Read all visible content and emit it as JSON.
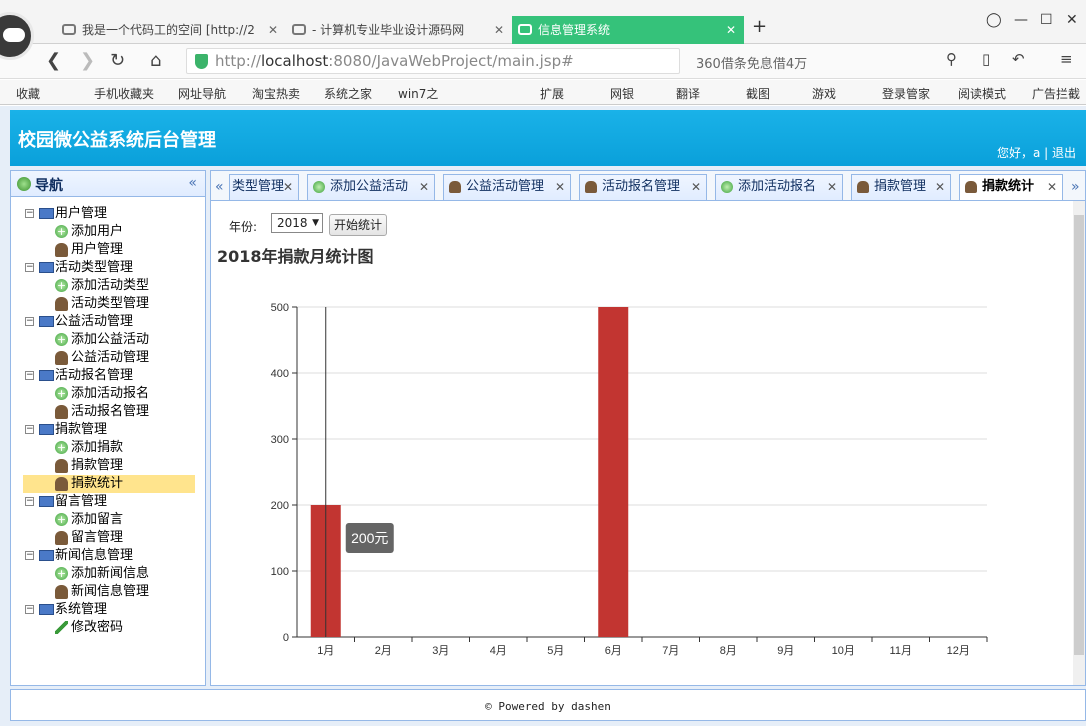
{
  "browser": {
    "tabs": [
      {
        "label": "我是一个代码工的空间 [http://2"
      },
      {
        "label": "- 计算机专业毕业设计源码网"
      },
      {
        "label": "信息管理系统"
      }
    ],
    "new_tab": "+",
    "url_host": "localhost",
    "url_pre": "http://",
    "url_rest": ":8080/JavaWebProject/main.jsp#",
    "news": "360借条免息借4万",
    "bookmarks": [
      "收藏",
      "手机收藏夹",
      "网址导航",
      "淘宝热卖",
      "系统之家",
      "win7之",
      "扩展",
      "网银",
      "翻译",
      "截图",
      "游戏",
      "登录管家",
      "阅读模式",
      "广告拦截"
    ]
  },
  "app": {
    "title": "校园微公益系统后台管理",
    "user_greeting": "您好，a",
    "logout": "退出"
  },
  "nav": {
    "title": "导航",
    "collapse": "«",
    "groups": [
      {
        "label": "用户管理",
        "items": [
          "添加用户",
          "用户管理"
        ]
      },
      {
        "label": "活动类型管理",
        "items": [
          "添加活动类型",
          "活动类型管理"
        ]
      },
      {
        "label": "公益活动管理",
        "items": [
          "添加公益活动",
          "公益活动管理"
        ]
      },
      {
        "label": "活动报名管理",
        "items": [
          "添加活动报名",
          "活动报名管理"
        ]
      },
      {
        "label": "捐款管理",
        "items": [
          "添加捐款",
          "捐款管理",
          "捐款统计"
        ]
      },
      {
        "label": "留言管理",
        "items": [
          "添加留言",
          "留言管理"
        ]
      },
      {
        "label": "新闻信息管理",
        "items": [
          "添加新闻信息",
          "新闻信息管理"
        ]
      },
      {
        "label": "系统管理",
        "items": [
          "修改密码"
        ]
      }
    ]
  },
  "tabs": [
    "类型管理",
    "添加公益活动",
    "公益活动管理",
    "活动报名管理",
    "添加活动报名",
    "捐款管理",
    "捐款统计"
  ],
  "filter": {
    "year_label": "年份:",
    "year_value": "2018",
    "button": "开始统计"
  },
  "chart_title": "2018年捐款月统计图",
  "chart_data": {
    "type": "bar",
    "title": "2018年捐款月统计图",
    "categories": [
      "1月",
      "2月",
      "3月",
      "4月",
      "5月",
      "6月",
      "7月",
      "8月",
      "9月",
      "10月",
      "11月",
      "12月"
    ],
    "values": [
      200,
      0,
      0,
      0,
      0,
      500,
      0,
      0,
      0,
      0,
      0,
      0
    ],
    "ylim": [
      0,
      500
    ],
    "yticks": [
      "0",
      "100",
      "200",
      "300",
      "400",
      "500"
    ],
    "grid": true,
    "bar_color": "#c23531",
    "tooltip": "200元"
  },
  "footer": "© Powered by dashen",
  "colors": {
    "header": "#0aa0da",
    "selected": "#ffe48d"
  }
}
